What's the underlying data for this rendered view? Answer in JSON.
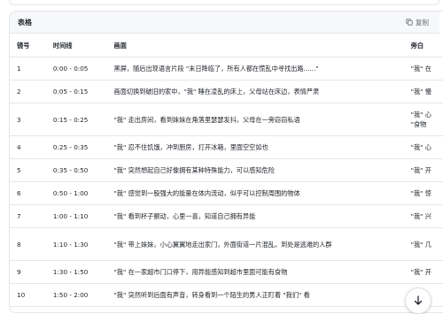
{
  "panel": {
    "title": "表格",
    "copy_label": "复制"
  },
  "table": {
    "headers": [
      "镜号",
      "时间线",
      "画面",
      "旁白"
    ],
    "rows": [
      {
        "no": "1",
        "time": "0:00 - 0:05",
        "scene": "黑屏，随后出现语言片段 \"末日降临了，所有人都在慌乱中寻找出路......\"",
        "narration": "\"我\" 在"
      },
      {
        "no": "2",
        "time": "0:05 - 0:15",
        "scene": "画面切换到破旧的家中，\"我\" 睡在凌乱的床上，父母站在床边，表情严肃",
        "narration": "\"我\" 慢"
      },
      {
        "no": "3",
        "time": "0:15 - 0:25",
        "scene": "\"我\" 走出房间，看到妹妹在角落里瑟瑟发抖，父母在一旁窃窃私语",
        "narration": "\"我\" 心\n\"食物"
      },
      {
        "no": "4",
        "time": "0:25 - 0:35",
        "scene": "\"我\" 忍不住饥饿，冲到厨房，打开冰箱，里面空空如也",
        "narration": "\"我\" 心"
      },
      {
        "no": "5",
        "time": "0:35 - 0:50",
        "scene": "\"我\" 突然想起自己好像拥有某种特殊能力，可以感知危险",
        "narration": "\"我\" 开"
      },
      {
        "no": "6",
        "time": "0:50 - 1:00",
        "scene": "\"我\" 感觉到一股强大的能量在体内流动，似乎可以控制周围的物体",
        "narration": "\"我\" 惊"
      },
      {
        "no": "7",
        "time": "1:00 - 1:10",
        "scene": "\"我\" 看到杯子颤动，心里一喜，知道自己拥有异能",
        "narration": "\"我\" 兴"
      },
      {
        "no": "8",
        "time": "1:10 - 1:30",
        "scene": "\"我\" 带上妹妹，小心翼翼地走出家门，外面街道一片混乱，到处是逃难的人群",
        "narration": "\"我\" 几"
      },
      {
        "no": "9",
        "time": "1:30 - 1:50",
        "scene": "\"我\" 在一家超市门口停下，用异能感知到超市里面可能有食物",
        "narration": "\"我\" 开"
      },
      {
        "no": "10",
        "time": "1:50 - 2:00",
        "scene": "\"我\" 突然听到后面有声音，转身看到一个陌生的男人正盯着 \"我们\" 看",
        "narration": "\"我\""
      }
    ]
  },
  "icons": {
    "copy": "copy-icon",
    "scroll": "arrow-down-icon"
  }
}
